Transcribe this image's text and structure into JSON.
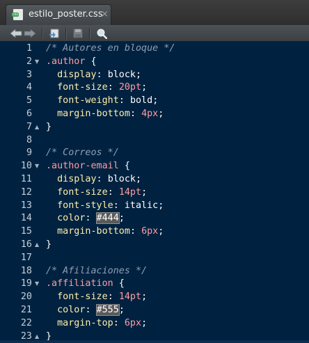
{
  "tab": {
    "filename": "estilo_poster.css",
    "close_glyph": "×",
    "icon": "css-file-icon"
  },
  "toolbar": {
    "icons": [
      "back-arrow-icon",
      "forward-arrow-icon",
      "go-to-file-icon",
      "save-icon",
      "search-icon"
    ]
  },
  "colors": {
    "background": "#002240",
    "comment": "#8f9fb4",
    "selector": "#ff9da4",
    "property": "#ffeead",
    "value": "#ffffff",
    "color_swatch_bg": "#5a5a5a"
  },
  "lines": [
    {
      "n": "1",
      "fold": "",
      "tokens": [
        {
          "t": "comment",
          "v": "/* Autores en bloque */"
        }
      ]
    },
    {
      "n": "2",
      "fold": "▼",
      "tokens": [
        {
          "t": "selector",
          "v": ".author"
        },
        {
          "t": "punc",
          "v": " {"
        }
      ]
    },
    {
      "n": "3",
      "fold": "",
      "tokens": [
        {
          "t": "indent",
          "v": "  "
        },
        {
          "t": "prop",
          "v": "display"
        },
        {
          "t": "punc",
          "v": ": "
        },
        {
          "t": "value",
          "v": "block"
        },
        {
          "t": "punc",
          "v": ";"
        }
      ]
    },
    {
      "n": "4",
      "fold": "",
      "tokens": [
        {
          "t": "indent",
          "v": "  "
        },
        {
          "t": "prop",
          "v": "font-size"
        },
        {
          "t": "punc",
          "v": ": "
        },
        {
          "t": "number",
          "v": "20pt"
        },
        {
          "t": "punc",
          "v": ";"
        }
      ]
    },
    {
      "n": "5",
      "fold": "",
      "tokens": [
        {
          "t": "indent",
          "v": "  "
        },
        {
          "t": "prop",
          "v": "font-weight"
        },
        {
          "t": "punc",
          "v": ": "
        },
        {
          "t": "value",
          "v": "bold"
        },
        {
          "t": "punc",
          "v": ";"
        }
      ]
    },
    {
      "n": "6",
      "fold": "",
      "tokens": [
        {
          "t": "indent",
          "v": "  "
        },
        {
          "t": "prop",
          "v": "margin-bottom"
        },
        {
          "t": "punc",
          "v": ": "
        },
        {
          "t": "number",
          "v": "4px"
        },
        {
          "t": "punc",
          "v": ";"
        }
      ]
    },
    {
      "n": "7",
      "fold": "▲",
      "tokens": [
        {
          "t": "punc",
          "v": "}"
        }
      ]
    },
    {
      "n": "8",
      "fold": "",
      "tokens": []
    },
    {
      "n": "9",
      "fold": "",
      "tokens": [
        {
          "t": "comment",
          "v": "/* Correos */"
        }
      ]
    },
    {
      "n": "10",
      "fold": "▼",
      "tokens": [
        {
          "t": "selector",
          "v": ".author-email"
        },
        {
          "t": "punc",
          "v": " {"
        }
      ]
    },
    {
      "n": "11",
      "fold": "",
      "tokens": [
        {
          "t": "indent",
          "v": "  "
        },
        {
          "t": "prop",
          "v": "display"
        },
        {
          "t": "punc",
          "v": ": "
        },
        {
          "t": "value",
          "v": "block"
        },
        {
          "t": "punc",
          "v": ";"
        }
      ]
    },
    {
      "n": "12",
      "fold": "",
      "tokens": [
        {
          "t": "indent",
          "v": "  "
        },
        {
          "t": "prop",
          "v": "font-size"
        },
        {
          "t": "punc",
          "v": ": "
        },
        {
          "t": "number",
          "v": "14pt"
        },
        {
          "t": "punc",
          "v": ";"
        }
      ]
    },
    {
      "n": "13",
      "fold": "",
      "tokens": [
        {
          "t": "indent",
          "v": "  "
        },
        {
          "t": "prop",
          "v": "font-style"
        },
        {
          "t": "punc",
          "v": ": "
        },
        {
          "t": "value",
          "v": "italic"
        },
        {
          "t": "punc",
          "v": ";"
        }
      ]
    },
    {
      "n": "14",
      "fold": "",
      "tokens": [
        {
          "t": "indent",
          "v": "  "
        },
        {
          "t": "prop",
          "v": "color"
        },
        {
          "t": "punc",
          "v": ": "
        },
        {
          "t": "color",
          "v": "#444"
        },
        {
          "t": "punc",
          "v": ";"
        }
      ]
    },
    {
      "n": "15",
      "fold": "",
      "tokens": [
        {
          "t": "indent",
          "v": "  "
        },
        {
          "t": "prop",
          "v": "margin-bottom"
        },
        {
          "t": "punc",
          "v": ": "
        },
        {
          "t": "number",
          "v": "6px"
        },
        {
          "t": "punc",
          "v": ";"
        }
      ]
    },
    {
      "n": "16",
      "fold": "▲",
      "tokens": [
        {
          "t": "punc",
          "v": "}"
        }
      ]
    },
    {
      "n": "17",
      "fold": "",
      "tokens": []
    },
    {
      "n": "18",
      "fold": "",
      "tokens": [
        {
          "t": "comment",
          "v": "/* Afiliaciones */"
        }
      ]
    },
    {
      "n": "19",
      "fold": "▼",
      "tokens": [
        {
          "t": "selector",
          "v": ".affiliation"
        },
        {
          "t": "punc",
          "v": " {"
        }
      ]
    },
    {
      "n": "20",
      "fold": "",
      "tokens": [
        {
          "t": "indent",
          "v": "  "
        },
        {
          "t": "prop",
          "v": "font-size"
        },
        {
          "t": "punc",
          "v": ": "
        },
        {
          "t": "number",
          "v": "14pt"
        },
        {
          "t": "punc",
          "v": ";"
        }
      ]
    },
    {
      "n": "21",
      "fold": "",
      "tokens": [
        {
          "t": "indent",
          "v": "  "
        },
        {
          "t": "prop",
          "v": "color"
        },
        {
          "t": "punc",
          "v": ": "
        },
        {
          "t": "color",
          "v": "#555"
        },
        {
          "t": "punc",
          "v": ";"
        }
      ]
    },
    {
      "n": "22",
      "fold": "",
      "tokens": [
        {
          "t": "indent",
          "v": "  "
        },
        {
          "t": "prop",
          "v": "margin-top"
        },
        {
          "t": "punc",
          "v": ": "
        },
        {
          "t": "number",
          "v": "6px"
        },
        {
          "t": "punc",
          "v": ";"
        }
      ]
    },
    {
      "n": "23",
      "fold": "▲",
      "tokens": [
        {
          "t": "punc",
          "v": "}"
        }
      ]
    }
  ]
}
